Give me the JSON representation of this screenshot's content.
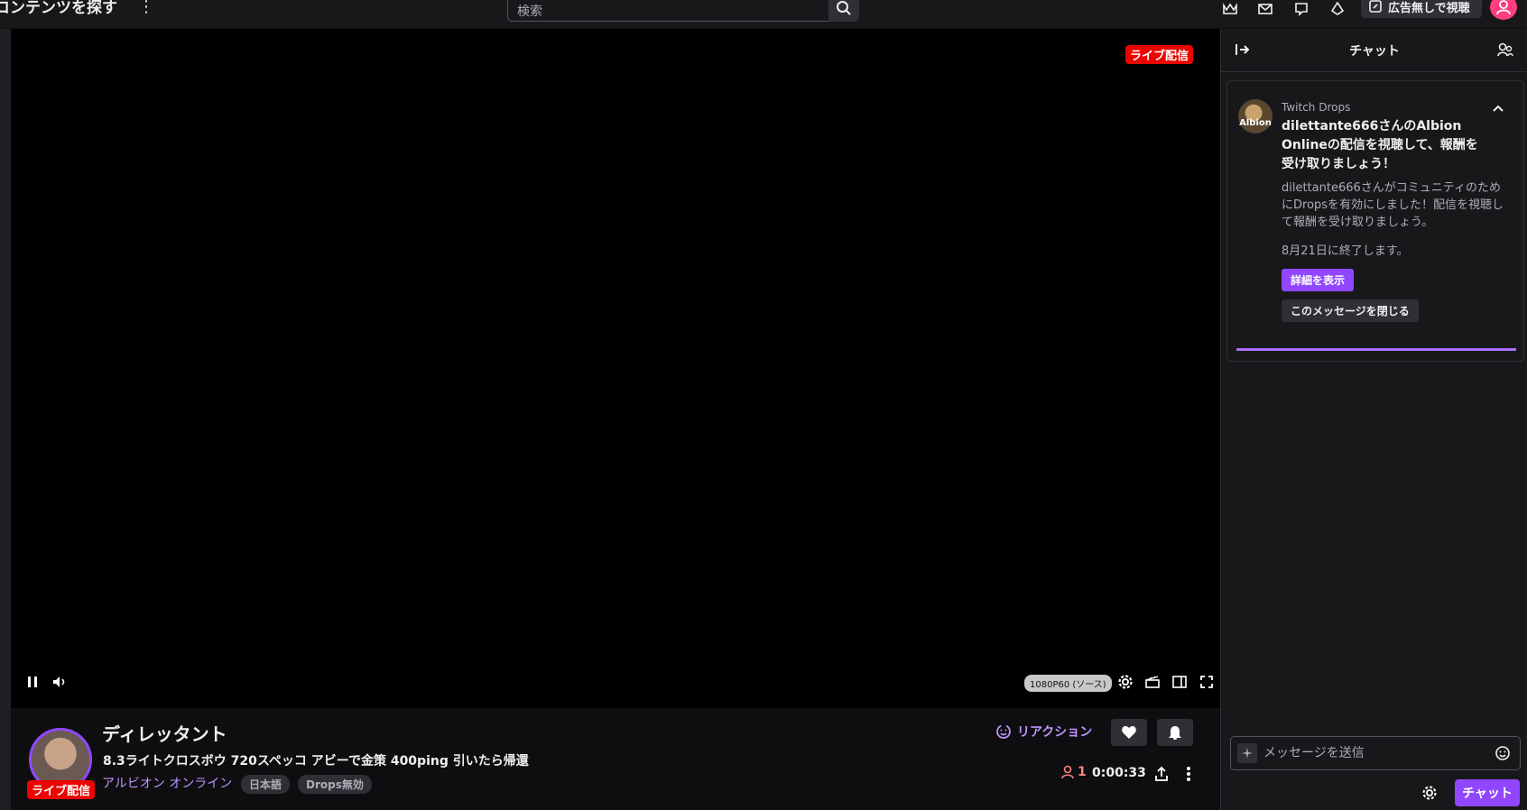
{
  "topbar": {
    "nav_title": "コンテンツを探す",
    "search_placeholder": "検索",
    "ad_free_label": "広告無しで視聴"
  },
  "player": {
    "live_badge": "ライブ配信",
    "quality": "1080P60 (ソース)"
  },
  "channel": {
    "name": "ディレッタント",
    "stream_title": "8.3ライトクロスボウ 720スペッコ アビーで金策 400ping 引いたら帰還",
    "game": "アルビオン オンライン",
    "tags": [
      "日本語",
      "Drops無効"
    ],
    "live_badge": "ライブ配信",
    "reaction_label": "リアクション",
    "viewer_count": "1",
    "uptime": "0:00:33"
  },
  "chat": {
    "title": "チャット",
    "drops": {
      "label": "Twitch Drops",
      "headline": "dilettante666さんのAlbion Onlineの配信を視聴して、報酬を受け取りましょう！",
      "description": "dilettante666さんがコミュニティのためにDropsを有効にしました！配信を視聴して報酬を受け取りましょう。",
      "end_date": "8月21日に終了します。",
      "details_button": "詳細を表示",
      "dismiss_button": "このメッセージを閉じる",
      "avatar_text": "Albion",
      "progress": 1.0
    },
    "input_placeholder": "メッセージを送信",
    "send_button": "チャット"
  },
  "colors": {
    "accent": "#9147ff",
    "live": "#eb0400",
    "link": "#bf94ff",
    "background": "#18181b"
  }
}
